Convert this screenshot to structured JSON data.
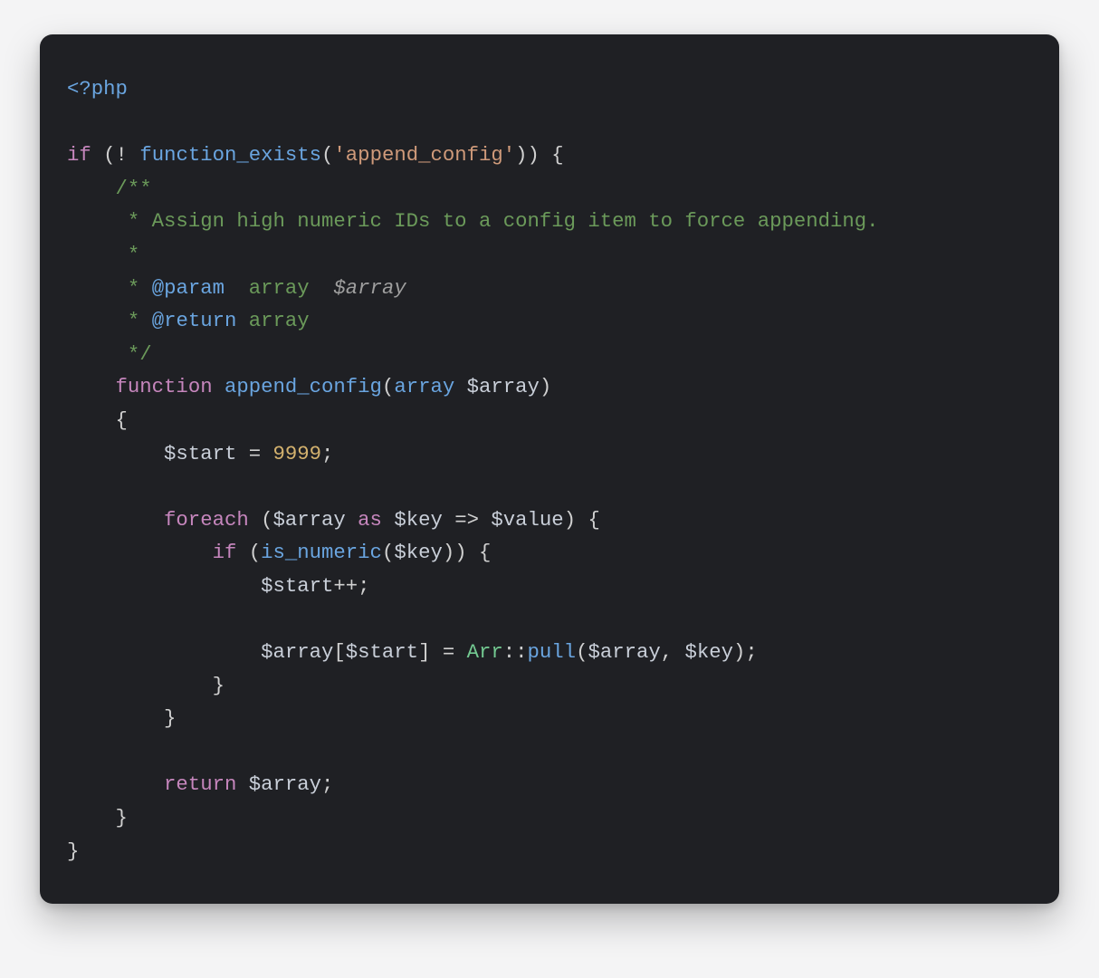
{
  "background": "#f4f4f5",
  "card_background": "#1f2024",
  "card_radius_px": 14,
  "font_family": "monospace",
  "font_size_px": 22.3,
  "line_height_px": 36.6,
  "language": "php",
  "colors": {
    "open_tag": "#6aa5e0",
    "keyword": "#c686bd",
    "punct": "#d0d0d0",
    "function": "#6aa5e0",
    "string": "#cf9a7a",
    "comment": "#6b9a5a",
    "comment_var": "#9e9e9e",
    "type": "#6aa5e0",
    "variable": "#c9cfd9",
    "number": "#d4b26e",
    "class": "#73c991",
    "default": "#d6d6d6"
  },
  "raw_code": "<?php\n\nif (! function_exists('append_config')) {\n    /**\n     * Assign high numeric IDs to a config item to force appending.\n     *\n     * @param  array  $array\n     * @return array\n     */\n    function append_config(array $array)\n    {\n        $start = 9999;\n\n        foreach ($array as $key => $value) {\n            if (is_numeric($key)) {\n                $start++;\n\n                $array[$start] = Arr::pull($array, $key);\n            }\n        }\n\n        return $array;\n    }\n}",
  "lines": [
    {
      "indent": 0,
      "tokens": [
        {
          "cls": "c-open",
          "t": "<?php"
        }
      ]
    },
    {
      "indent": 0,
      "tokens": []
    },
    {
      "indent": 0,
      "tokens": [
        {
          "cls": "c-kw",
          "t": "if"
        },
        {
          "cls": "c-punct",
          "t": " ("
        },
        {
          "cls": "c-op",
          "t": "!"
        },
        {
          "cls": "c-punct",
          "t": " "
        },
        {
          "cls": "c-fn",
          "t": "function_exists"
        },
        {
          "cls": "c-punct",
          "t": "("
        },
        {
          "cls": "c-str",
          "t": "'append_config'"
        },
        {
          "cls": "c-punct",
          "t": ")) {"
        }
      ]
    },
    {
      "indent": 1,
      "tokens": [
        {
          "cls": "c-cmt",
          "t": "/**"
        }
      ]
    },
    {
      "indent": 1,
      "tokens": [
        {
          "cls": "c-cmt",
          "t": " * Assign high numeric IDs to a config item to force appending."
        }
      ]
    },
    {
      "indent": 1,
      "tokens": [
        {
          "cls": "c-cmt",
          "t": " *"
        }
      ]
    },
    {
      "indent": 1,
      "tokens": [
        {
          "cls": "c-cmt",
          "t": " * "
        },
        {
          "cls": "c-fn",
          "t": "@param"
        },
        {
          "cls": "c-cmt",
          "t": "  array  "
        },
        {
          "cls": "c-cmt-var",
          "t": "$array"
        }
      ]
    },
    {
      "indent": 1,
      "tokens": [
        {
          "cls": "c-cmt",
          "t": " * "
        },
        {
          "cls": "c-fn",
          "t": "@return"
        },
        {
          "cls": "c-cmt",
          "t": " array"
        }
      ]
    },
    {
      "indent": 1,
      "tokens": [
        {
          "cls": "c-cmt",
          "t": " */"
        }
      ]
    },
    {
      "indent": 1,
      "tokens": [
        {
          "cls": "c-kw",
          "t": "function"
        },
        {
          "cls": "c-punct",
          "t": " "
        },
        {
          "cls": "c-fn",
          "t": "append_config"
        },
        {
          "cls": "c-punct",
          "t": "("
        },
        {
          "cls": "c-type",
          "t": "array"
        },
        {
          "cls": "c-punct",
          "t": " "
        },
        {
          "cls": "c-var",
          "t": "$array"
        },
        {
          "cls": "c-punct",
          "t": ")"
        }
      ]
    },
    {
      "indent": 1,
      "tokens": [
        {
          "cls": "c-punct",
          "t": "{"
        }
      ]
    },
    {
      "indent": 2,
      "tokens": [
        {
          "cls": "c-var",
          "t": "$start"
        },
        {
          "cls": "c-punct",
          "t": " = "
        },
        {
          "cls": "c-num",
          "t": "9999"
        },
        {
          "cls": "c-punct",
          "t": ";"
        }
      ]
    },
    {
      "indent": 0,
      "tokens": []
    },
    {
      "indent": 2,
      "tokens": [
        {
          "cls": "c-kw",
          "t": "foreach"
        },
        {
          "cls": "c-punct",
          "t": " ("
        },
        {
          "cls": "c-var",
          "t": "$array"
        },
        {
          "cls": "c-punct",
          "t": " "
        },
        {
          "cls": "c-kw",
          "t": "as"
        },
        {
          "cls": "c-punct",
          "t": " "
        },
        {
          "cls": "c-var",
          "t": "$key"
        },
        {
          "cls": "c-punct",
          "t": " => "
        },
        {
          "cls": "c-var",
          "t": "$value"
        },
        {
          "cls": "c-punct",
          "t": ") {"
        }
      ]
    },
    {
      "indent": 3,
      "tokens": [
        {
          "cls": "c-kw",
          "t": "if"
        },
        {
          "cls": "c-punct",
          "t": " ("
        },
        {
          "cls": "c-fn",
          "t": "is_numeric"
        },
        {
          "cls": "c-punct",
          "t": "("
        },
        {
          "cls": "c-var",
          "t": "$key"
        },
        {
          "cls": "c-punct",
          "t": ")) {"
        }
      ]
    },
    {
      "indent": 4,
      "tokens": [
        {
          "cls": "c-var",
          "t": "$start"
        },
        {
          "cls": "c-op",
          "t": "++"
        },
        {
          "cls": "c-punct",
          "t": ";"
        }
      ]
    },
    {
      "indent": 0,
      "tokens": []
    },
    {
      "indent": 4,
      "tokens": [
        {
          "cls": "c-var",
          "t": "$array"
        },
        {
          "cls": "c-punct",
          "t": "["
        },
        {
          "cls": "c-var",
          "t": "$start"
        },
        {
          "cls": "c-punct",
          "t": "] = "
        },
        {
          "cls": "c-class",
          "t": "Arr"
        },
        {
          "cls": "c-punct",
          "t": "::"
        },
        {
          "cls": "c-fn",
          "t": "pull"
        },
        {
          "cls": "c-punct",
          "t": "("
        },
        {
          "cls": "c-var",
          "t": "$array"
        },
        {
          "cls": "c-punct",
          "t": ", "
        },
        {
          "cls": "c-var",
          "t": "$key"
        },
        {
          "cls": "c-punct",
          "t": ");"
        }
      ]
    },
    {
      "indent": 3,
      "tokens": [
        {
          "cls": "c-punct",
          "t": "}"
        }
      ]
    },
    {
      "indent": 2,
      "tokens": [
        {
          "cls": "c-punct",
          "t": "}"
        }
      ]
    },
    {
      "indent": 0,
      "tokens": []
    },
    {
      "indent": 2,
      "tokens": [
        {
          "cls": "c-kw",
          "t": "return"
        },
        {
          "cls": "c-punct",
          "t": " "
        },
        {
          "cls": "c-var",
          "t": "$array"
        },
        {
          "cls": "c-punct",
          "t": ";"
        }
      ]
    },
    {
      "indent": 1,
      "tokens": [
        {
          "cls": "c-punct",
          "t": "}"
        }
      ]
    },
    {
      "indent": 0,
      "tokens": [
        {
          "cls": "c-punct",
          "t": "}"
        }
      ]
    }
  ]
}
